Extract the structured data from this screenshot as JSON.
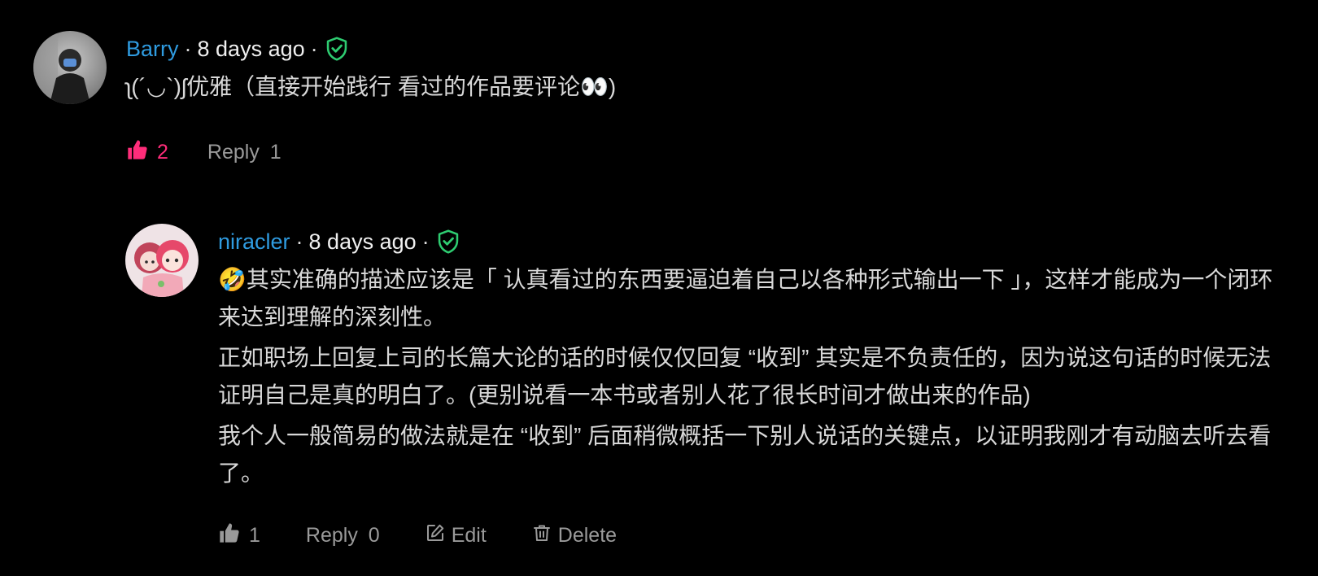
{
  "comments": [
    {
      "author": "Barry",
      "separator": "·",
      "time": "8 days ago",
      "text": [
        "ʅ(´◡`)ʃ优雅（直接开始践行 看过的作品要评论👀)"
      ],
      "likes": "2",
      "reply_label": "Reply",
      "reply_count": "1",
      "colors": {
        "author": "#2f9be0",
        "like_active": "#ff2d7a",
        "verified": "#2ecc71"
      },
      "icons": {
        "verified": "shield-check-icon",
        "like": "thumbs-up-icon"
      }
    }
  ],
  "reply": {
    "author": "niracler",
    "separator": "·",
    "time": "8 days ago",
    "paragraphs": [
      "🤣其实准确的描述应该是「 认真看过的东西要逼迫着自己以各种形式输出一下 」，这样才能成为一个闭环来达到理解的深刻性。",
      "正如职场上回复上司的长篇大论的话的时候仅仅回复 “收到” 其实是不负责任的，因为说这句话的时候无法证明自己是真的明白了。(更别说看一本书或者别人花了很长时间才做出来的作品)",
      "我个人一般简易的做法就是在 “收到” 后面稍微概括一下别人说话的关键点，以证明我刚才有动脑去听去看了。"
    ],
    "likes": "1",
    "reply_label": "Reply",
    "reply_count": "0",
    "edit_label": "Edit",
    "delete_label": "Delete",
    "icons": {
      "verified": "shield-check-icon",
      "like": "thumbs-up-icon",
      "edit": "edit-icon",
      "delete": "trash-icon"
    }
  }
}
